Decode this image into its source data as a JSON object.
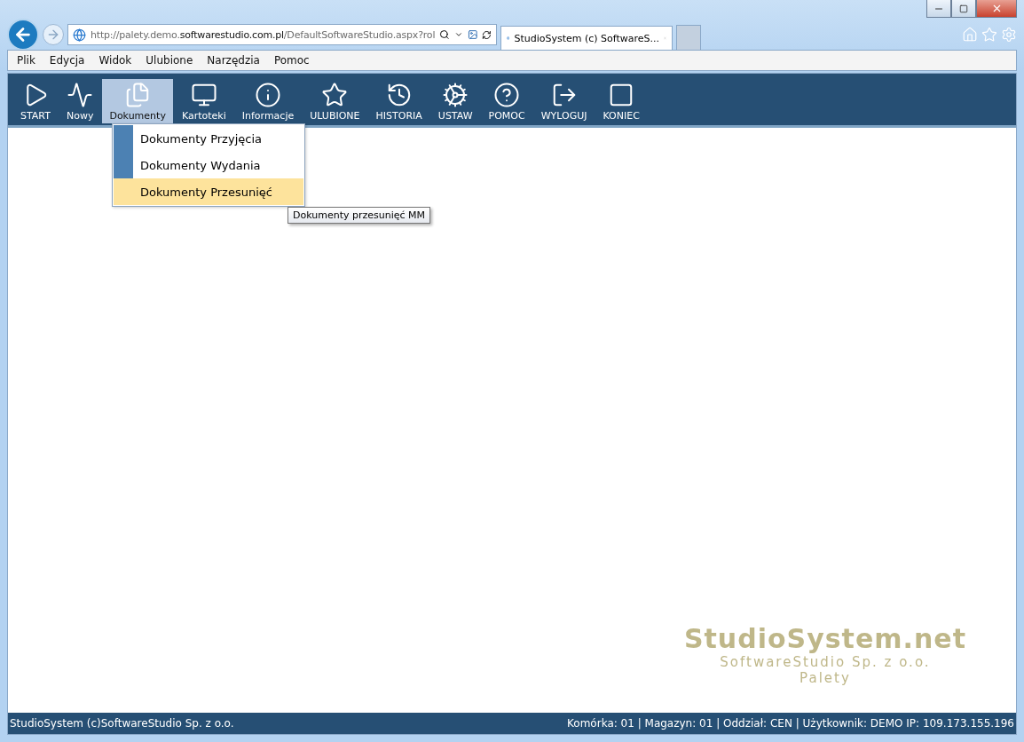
{
  "browser": {
    "address": "http://palety.demo.**softwarestudio.com.pl**/DefaultSoftwareStudio.aspx?rol",
    "tabs": [
      {
        "title": "StudioSystem (c) SoftwareS...",
        "selected": true
      }
    ],
    "menu": [
      "Plik",
      "Edycja",
      "Widok",
      "Ulubione",
      "Narzędzia",
      "Pomoc"
    ]
  },
  "toolbar": [
    {
      "label": "START",
      "kind": "start",
      "selected": false
    },
    {
      "label": "Nowy",
      "kind": "new",
      "selected": false
    },
    {
      "label": "Dokumenty",
      "kind": "documents",
      "selected": true
    },
    {
      "label": "Kartoteki",
      "kind": "records",
      "selected": false
    },
    {
      "label": "Informacje",
      "kind": "info",
      "selected": false
    },
    {
      "label": "ULUBIONE",
      "kind": "favorites",
      "selected": false
    },
    {
      "label": "HISTORIA",
      "kind": "history",
      "selected": false
    },
    {
      "label": "USTAW",
      "kind": "settings",
      "selected": false
    },
    {
      "label": "POMOC",
      "kind": "help",
      "selected": false
    },
    {
      "label": "WYLOGUJ",
      "kind": "logout",
      "selected": false
    },
    {
      "label": "KONIEC",
      "kind": "exit",
      "selected": false
    }
  ],
  "dropdown": {
    "items": [
      {
        "label": "Dokumenty Przyjęcia",
        "selected": false
      },
      {
        "label": "Dokumenty Wydania",
        "selected": false
      },
      {
        "label": "Dokumenty Przesunięć",
        "selected": true
      }
    ],
    "tooltip": "Dokumenty przesunięć MM"
  },
  "brand": {
    "title": "StudioSystem.net",
    "company": "SoftwareStudio Sp. z o.o.",
    "product": "Palety"
  },
  "status_bar": {
    "left": "StudioSystem (c)SoftwareStudio Sp. z o.o.",
    "right": "Komórka: 01 | Magazyn: 01 | Oddział: CEN | Użytkownik: DEMO IP: 109.173.155.196"
  }
}
